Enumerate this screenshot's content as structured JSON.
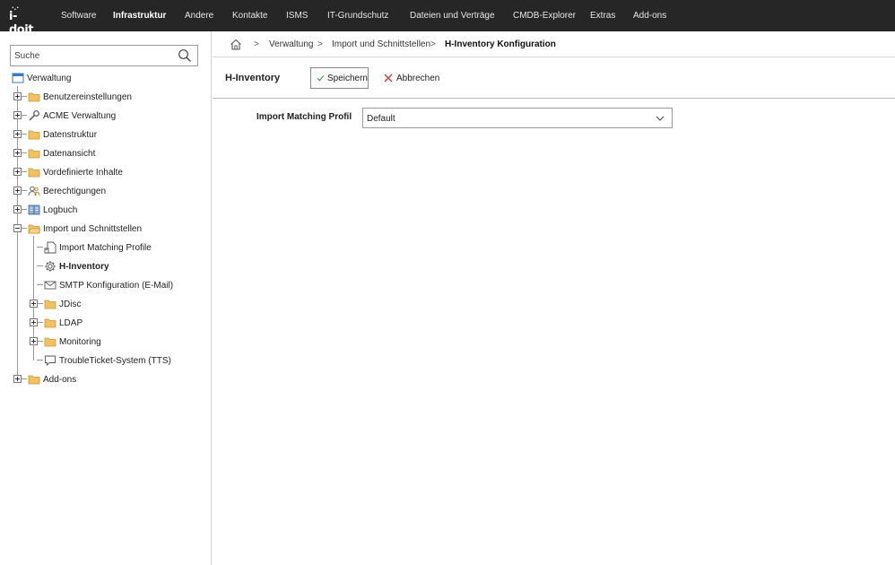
{
  "app": {
    "logo_text": "i-doit"
  },
  "nav": {
    "items": [
      {
        "label": "Software"
      },
      {
        "label": "Infrastruktur"
      },
      {
        "label": "Andere"
      },
      {
        "label": "Kontakte"
      },
      {
        "label": "ISMS"
      },
      {
        "label": "IT-Grundschutz"
      },
      {
        "label": "Dateien und Verträge"
      },
      {
        "label": "CMDB-Explorer"
      },
      {
        "label": "Extras"
      },
      {
        "label": "Add-ons"
      }
    ],
    "active": "Infrastruktur"
  },
  "sidebar": {
    "search": {
      "placeholder": "Suche",
      "value": ""
    },
    "tree": [
      {
        "label": "Verwaltung",
        "icon": "window-icon"
      },
      {
        "label": "Benutzereinstellungen",
        "icon": "folder-icon"
      },
      {
        "label": "ACME Verwaltung",
        "icon": "wrench-icon"
      },
      {
        "label": "Datenstruktur",
        "icon": "folder-icon"
      },
      {
        "label": "Datenansicht",
        "icon": "folder-icon"
      },
      {
        "label": "Vordefinierte Inhalte",
        "icon": "folder-icon"
      },
      {
        "label": "Berechtigungen",
        "icon": "users-icon"
      },
      {
        "label": "Logbuch",
        "icon": "book-icon"
      },
      {
        "label": "Import und Schnittstellen",
        "icon": "folder-open-icon"
      },
      {
        "label": "Import Matching Profile",
        "icon": "document-link-icon"
      },
      {
        "label": "H-Inventory",
        "icon": "gear-icon"
      },
      {
        "label": "SMTP Konfiguration (E-Mail)",
        "icon": "mail-icon"
      },
      {
        "label": "JDisc",
        "icon": "folder-icon"
      },
      {
        "label": "LDAP",
        "icon": "folder-icon"
      },
      {
        "label": "Monitoring",
        "icon": "folder-icon"
      },
      {
        "label": "TroubleTicket-System (TTS)",
        "icon": "comment-icon"
      },
      {
        "label": "Add-ons",
        "icon": "folder-icon"
      }
    ]
  },
  "breadcrumb": {
    "items": [
      {
        "label": "Verwaltung"
      },
      {
        "label": "Import und Schnittstellen"
      },
      {
        "label": "H-Inventory Konfiguration"
      }
    ],
    "separator": ">"
  },
  "toolbar": {
    "title": "H-Inventory",
    "save_label": "Speichern",
    "cancel_label": "Abbrechen"
  },
  "form": {
    "profile_label": "Import Matching Profil",
    "profile_value": "Default"
  },
  "colors": {
    "topbar": "#262626",
    "save_check": "#2a8a2a",
    "cancel_x": "#d33333",
    "folder": "#f2c261"
  }
}
